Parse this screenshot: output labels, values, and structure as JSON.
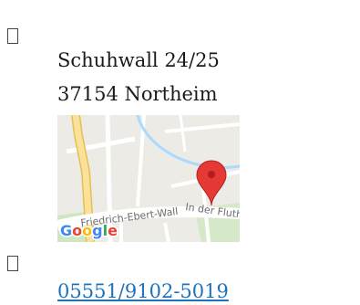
{
  "contact": {
    "address_icon": "map-marker-icon",
    "street": "Schuhwall 24/25",
    "city": "37154 Northeim",
    "phone_icon": "phone-icon",
    "phone": "05551/9102-5019"
  },
  "map": {
    "street_labels": [
      "Friedrich-Ebert-Wall",
      "In der Fluth"
    ],
    "provider": "Google",
    "marker_color": "#e53935"
  }
}
